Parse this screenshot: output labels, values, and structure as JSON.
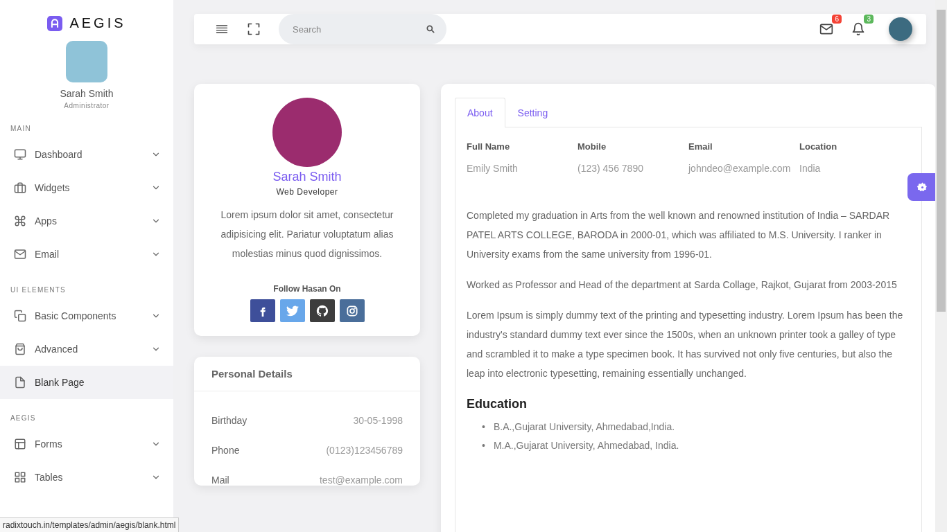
{
  "brand": {
    "name": "AEGIS"
  },
  "sidebar": {
    "user": {
      "name": "Sarah Smith",
      "role": "Administrator"
    },
    "sections": [
      {
        "title": "MAIN",
        "items": [
          {
            "label": "Dashboard",
            "expandable": true,
            "selected": false
          },
          {
            "label": "Widgets",
            "expandable": true,
            "selected": false
          },
          {
            "label": "Apps",
            "expandable": true,
            "selected": false
          },
          {
            "label": "Email",
            "expandable": true,
            "selected": false
          }
        ]
      },
      {
        "title": "UI ELEMENTS",
        "items": [
          {
            "label": "Basic Components",
            "expandable": true,
            "selected": false
          },
          {
            "label": "Advanced",
            "expandable": true,
            "selected": false
          },
          {
            "label": "Blank Page",
            "expandable": false,
            "selected": true
          }
        ]
      },
      {
        "title": "AEGIS",
        "items": [
          {
            "label": "Forms",
            "expandable": true,
            "selected": false
          },
          {
            "label": "Tables",
            "expandable": true,
            "selected": false
          }
        ]
      }
    ]
  },
  "header": {
    "search": {
      "placeholder": "Search"
    },
    "notifications": [
      {
        "count": "6",
        "color": "#f44336"
      },
      {
        "count": "3",
        "color": "#5cb85c"
      }
    ]
  },
  "profile": {
    "name": "Sarah Smith",
    "title": "Web Developer",
    "bio": "Lorem ipsum dolor sit amet, consectetur adipisicing elit. Pariatur voluptatum alias molestias minus quod dignissimos.",
    "follow_label": "Follow Hasan On",
    "social": [
      {
        "color": "#3e4f9a"
      },
      {
        "color": "#68a7ea"
      },
      {
        "color": "#3d3d3d"
      },
      {
        "color": "#4a6e9a"
      }
    ]
  },
  "personal_details": {
    "title": "Personal Details",
    "rows": [
      {
        "label": "Birthday",
        "value": "30-05-1998"
      },
      {
        "label": "Phone",
        "value": "(0123)123456789"
      },
      {
        "label": "Mail",
        "value": "test@example.com"
      }
    ]
  },
  "tabs": [
    {
      "label": "About",
      "selected": true
    },
    {
      "label": "Setting",
      "selected": false
    }
  ],
  "about": {
    "fields": [
      {
        "label": "Full Name",
        "value": "Emily Smith"
      },
      {
        "label": "Mobile",
        "value": "(123) 456 7890"
      },
      {
        "label": "Email",
        "value": "johndeo@example.com"
      },
      {
        "label": "Location",
        "value": "India"
      }
    ],
    "paragraphs": [
      "Completed my graduation in Arts from the well known and renowned institution of India – SARDAR PATEL ARTS COLLEGE, BARODA in 2000-01, which was affiliated to M.S. University. I ranker in University exams from the same university from 1996-01.",
      "Worked as Professor and Head of the department at Sarda Collage, Rajkot, Gujarat from 2003-2015",
      "Lorem Ipsum is simply dummy text of the printing and typesetting industry. Lorem Ipsum has been the industry's standard dummy text ever since the 1500s, when an unknown printer took a galley of type and scrambled it to make a type specimen book. It has survived not only five centuries, but also the leap into electronic typesetting, remaining essentially unchanged."
    ],
    "education_title": "Education",
    "education": [
      {
        "marker": "•",
        "text": "B.A.,Gujarat University, Ahmedabad,India."
      },
      {
        "marker": "•",
        "text": "M.A.,Gujarat University, Ahmedabad, India."
      }
    ]
  },
  "status_bar": {
    "url": "radixtouch.in/templates/admin/aegis/blank.html"
  }
}
